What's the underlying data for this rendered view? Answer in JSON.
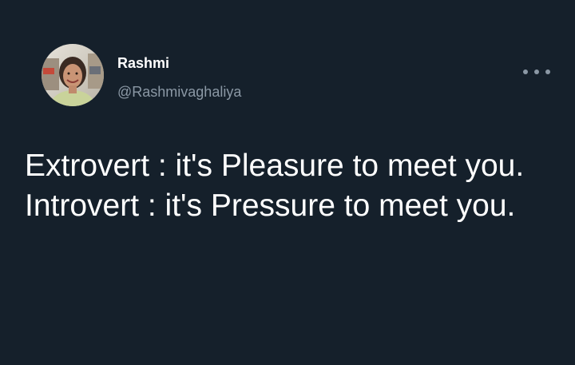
{
  "tweet": {
    "author": {
      "display_name": "Rashmi",
      "handle": "@Rashmivaghaliya"
    },
    "text_lines": [
      "Extrovert : it's Pleasure to meet you.",
      "Introvert : it's Pressure to meet you."
    ]
  },
  "icons": {
    "more": "more-options-icon",
    "avatar": "profile-avatar"
  },
  "colors": {
    "background": "#15202b",
    "primary_text": "#ffffff",
    "secondary_text": "#8b98a5"
  }
}
